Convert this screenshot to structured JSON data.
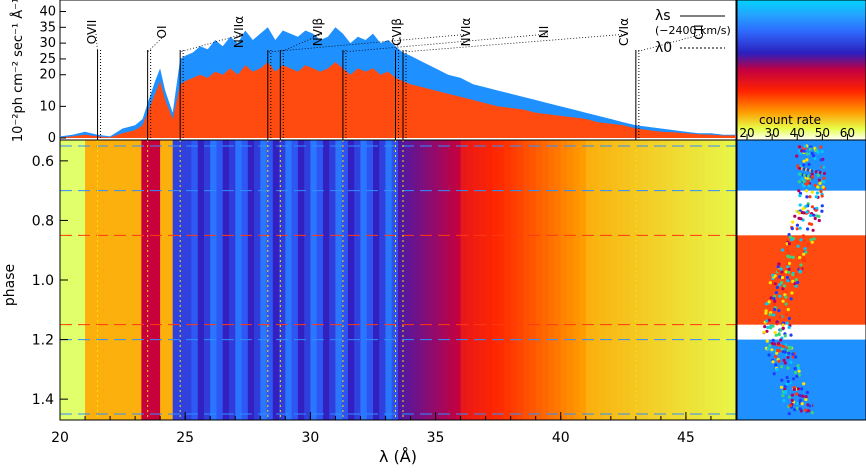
{
  "chart_data": [
    {
      "type": "area",
      "panel": "spectrum",
      "xlabel": "λ (Å)",
      "ylabel": "10⁻²ph cm⁻² sec⁻¹ Å⁻¹",
      "xlim": [
        20,
        47
      ],
      "ylim": [
        0,
        43
      ],
      "y_ticks": [
        "0",
        "10",
        "20",
        "25",
        "30",
        "35",
        "40"
      ],
      "y_tick_values": [
        0,
        10,
        20,
        25,
        30,
        35,
        40
      ],
      "series": [
        {
          "color": "#1e90ff",
          "x": [
            20.0,
            20.5,
            21.0,
            21.5,
            22.0,
            22.5,
            23.0,
            23.3,
            23.5,
            23.8,
            24.0,
            24.2,
            24.5,
            24.8,
            25.0,
            25.3,
            25.6,
            25.9,
            26.2,
            26.5,
            26.8,
            27.1,
            27.4,
            27.7,
            28.0,
            28.3,
            28.6,
            28.9,
            29.2,
            29.5,
            29.8,
            30.1,
            30.4,
            30.7,
            31.0,
            31.3,
            31.6,
            31.9,
            32.2,
            32.5,
            32.8,
            33.1,
            33.4,
            33.7,
            34.0,
            34.5,
            35.0,
            35.5,
            36.0,
            36.5,
            37.0,
            37.5,
            38.0,
            38.5,
            39.0,
            39.5,
            40.0,
            40.5,
            41.0,
            41.5,
            42.0,
            42.5,
            43.0,
            43.5,
            44.0,
            44.5,
            45.0,
            45.5,
            46.0,
            46.5,
            47.0
          ],
          "values": [
            0.5,
            1,
            2,
            1,
            0.5,
            3,
            4,
            6,
            11,
            18,
            22,
            15,
            8,
            25,
            26,
            27,
            29,
            28,
            31,
            29,
            32,
            30,
            34,
            31,
            33,
            35,
            31,
            34,
            33,
            32,
            34,
            33,
            31,
            32,
            35,
            33,
            30,
            32,
            31,
            33,
            30,
            31,
            29,
            27,
            26,
            24,
            22,
            20,
            19,
            17,
            16,
            15,
            14,
            13,
            12,
            11,
            10,
            9,
            8,
            7,
            6,
            5,
            4,
            3.5,
            3,
            2.5,
            2,
            1.5,
            1.5,
            1,
            1
          ]
        },
        {
          "color": "#ff4a10",
          "x": [
            20.0,
            20.5,
            21.0,
            21.5,
            22.0,
            22.5,
            23.0,
            23.3,
            23.5,
            23.8,
            24.0,
            24.2,
            24.5,
            24.8,
            25.0,
            25.3,
            25.6,
            25.9,
            26.2,
            26.5,
            26.8,
            27.1,
            27.4,
            27.7,
            28.0,
            28.3,
            28.6,
            28.9,
            29.2,
            29.5,
            29.8,
            30.1,
            30.4,
            30.7,
            31.0,
            31.3,
            31.6,
            31.9,
            32.2,
            32.5,
            32.8,
            33.1,
            33.4,
            33.7,
            34.0,
            34.5,
            35.0,
            35.5,
            36.0,
            36.5,
            37.0,
            37.5,
            38.0,
            38.5,
            39.0,
            39.5,
            40.0,
            40.5,
            41.0,
            41.5,
            42.0,
            42.5,
            43.0,
            43.5,
            44.0,
            44.5,
            45.0,
            45.5,
            46.0,
            46.5,
            47.0
          ],
          "values": [
            0.2,
            0.5,
            1,
            0.5,
            0.2,
            1.5,
            2.5,
            4,
            8,
            14,
            18,
            12,
            6,
            17,
            18,
            19,
            20,
            19,
            21,
            20,
            22,
            20,
            23,
            21,
            22,
            24,
            21,
            23,
            22,
            21,
            23,
            22,
            21,
            22,
            24,
            22,
            20,
            22,
            21,
            22,
            20,
            21,
            19,
            18,
            17,
            16,
            15,
            14,
            13,
            12,
            11,
            10,
            9.5,
            9,
            8,
            7.5,
            7,
            6.5,
            6,
            5,
            4.5,
            4,
            3,
            2.5,
            2,
            1.8,
            1.5,
            1.2,
            1,
            0.8,
            0.8
          ]
        }
      ],
      "line_labels": [
        {
          "text": "OVII",
          "x": 21.5
        },
        {
          "text": "OI",
          "x": 23.5
        },
        {
          "text": "NVIIα",
          "x": 24.8
        },
        {
          "text": "NVIβ",
          "x": 28.8
        },
        {
          "text": "CVIβ",
          "x": 33.4
        },
        {
          "text": "NVIα",
          "x": 28.3
        },
        {
          "text": "NI",
          "x": 31.3
        },
        {
          "text": "CVIα",
          "x": 33.7
        },
        {
          "text": "CII",
          "x": 43.0
        }
      ],
      "legend": {
        "entries": [
          "λs",
          "(−2400 km/s)",
          "λ0"
        ],
        "placement": "top-right"
      }
    },
    {
      "type": "heatmap",
      "panel": "dynamic-spectrum",
      "xlabel": "λ (Å)",
      "ylabel": "phase",
      "xlim": [
        20,
        47
      ],
      "ylim": [
        1.47,
        0.53
      ],
      "x_ticks": [
        "20",
        "25",
        "30",
        "35",
        "40",
        "45"
      ],
      "x_tick_values": [
        20,
        25,
        30,
        35,
        40,
        45
      ],
      "y_ticks": [
        "0.6",
        "0.8",
        "1.0",
        "1.2",
        "1.4"
      ],
      "y_tick_values": [
        0.6,
        0.8,
        1.0,
        1.2,
        1.4
      ],
      "blue_dashed_phases": [
        0.55,
        0.7,
        1.2,
        1.45
      ],
      "red_dashed_phases": [
        0.85,
        1.15
      ],
      "colorbar": {
        "label": "count rate",
        "ticks": [
          "20",
          "30",
          "40",
          "50",
          "60"
        ],
        "tick_values": [
          20,
          30,
          40,
          50,
          60
        ],
        "range": [
          18,
          65
        ],
        "placement": "top-right"
      }
    },
    {
      "type": "scatter",
      "panel": "phase-panel",
      "ylim": [
        1.47,
        0.53
      ],
      "bands": [
        {
          "from": 0.53,
          "to": 0.7,
          "color": "#1e90ff"
        },
        {
          "from": 0.85,
          "to": 1.15,
          "color": "#ff4a10"
        },
        {
          "from": 1.2,
          "to": 1.47,
          "color": "#1e90ff"
        }
      ]
    }
  ]
}
